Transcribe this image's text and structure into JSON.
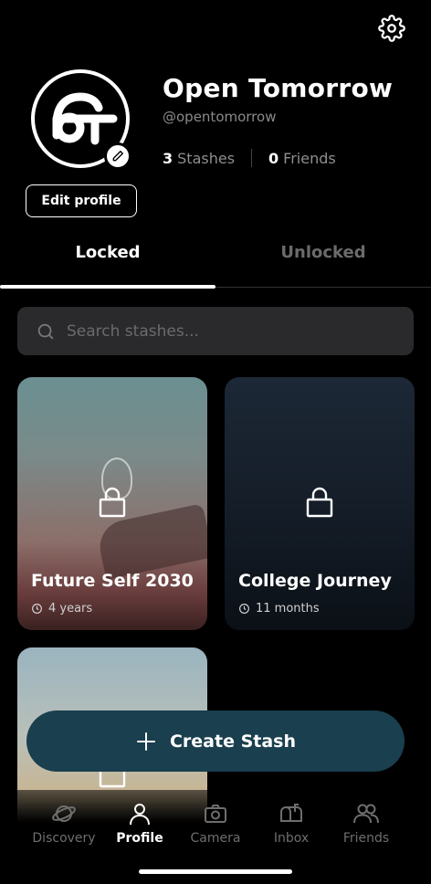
{
  "profile": {
    "name": "Open Tomorrow",
    "handle": "@opentomorrow",
    "stashes_count": "3",
    "stashes_label": "Stashes",
    "friends_count": "0",
    "friends_label": "Friends",
    "edit_label": "Edit profile"
  },
  "tabs": [
    {
      "label": "Locked",
      "active": true
    },
    {
      "label": "Unlocked",
      "active": false
    }
  ],
  "search": {
    "placeholder": "Search stashes..."
  },
  "stashes": [
    {
      "title": "Future Self 2030",
      "duration": "4 years"
    },
    {
      "title": "College Journey",
      "duration": "11 months"
    },
    {
      "title": "",
      "duration": ""
    }
  ],
  "create_label": "Create Stash",
  "nav": [
    {
      "label": "Discovery",
      "icon": "planet-icon"
    },
    {
      "label": "Profile",
      "icon": "person-icon"
    },
    {
      "label": "Camera",
      "icon": "camera-icon"
    },
    {
      "label": "Inbox",
      "icon": "mailbox-icon"
    },
    {
      "label": "Friends",
      "icon": "people-icon"
    }
  ],
  "colors": {
    "accent": "#1a3f4e",
    "background": "#000000"
  }
}
